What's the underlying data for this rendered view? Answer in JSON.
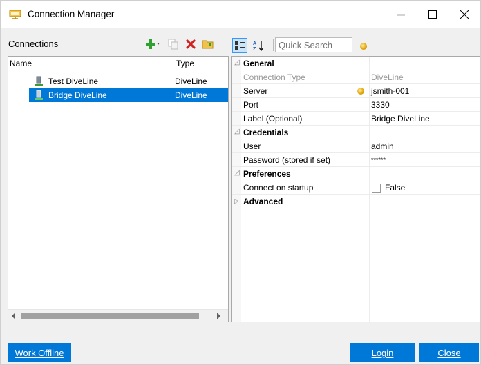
{
  "window": {
    "title": "Connection Manager",
    "controls": {
      "minimize": "—",
      "maximize": "☐",
      "close": "✕"
    }
  },
  "connections": {
    "header": "Connections",
    "toolbar": [
      "add-icon",
      "copy-icon",
      "delete-icon",
      "import-icon"
    ],
    "columns": {
      "name": "Name",
      "type": "Type"
    },
    "rows": [
      {
        "name": "Test DiveLine",
        "type": "DiveLine",
        "selected": false
      },
      {
        "name": "Bridge DiveLine",
        "type": "DiveLine",
        "selected": true
      }
    ]
  },
  "properties": {
    "quick_search_placeholder": "Quick Search",
    "categories": [
      {
        "label": "General",
        "expanded": true,
        "items": [
          {
            "name": "Connection Type",
            "value": "DiveLine",
            "disabled": true
          },
          {
            "name": "Server",
            "value": "jsmith-001",
            "icon": "status-dot-icon"
          },
          {
            "name": "Port",
            "value": "3330"
          },
          {
            "name": "Label (Optional)",
            "value": "Bridge DiveLine"
          }
        ]
      },
      {
        "label": "Credentials",
        "expanded": true,
        "items": [
          {
            "name": "User",
            "value": "admin"
          },
          {
            "name": "Password (stored if set)",
            "value": "******"
          }
        ]
      },
      {
        "label": "Preferences",
        "expanded": true,
        "items": [
          {
            "name": "Connect on startup",
            "value": "False",
            "checkbox": false
          }
        ]
      },
      {
        "label": "Advanced",
        "expanded": false,
        "items": []
      }
    ]
  },
  "buttons": {
    "work_offline": "Work Offline",
    "login": "Login",
    "close": "Close"
  },
  "colors": {
    "accent": "#0078d7",
    "selection": "#0078d7"
  }
}
